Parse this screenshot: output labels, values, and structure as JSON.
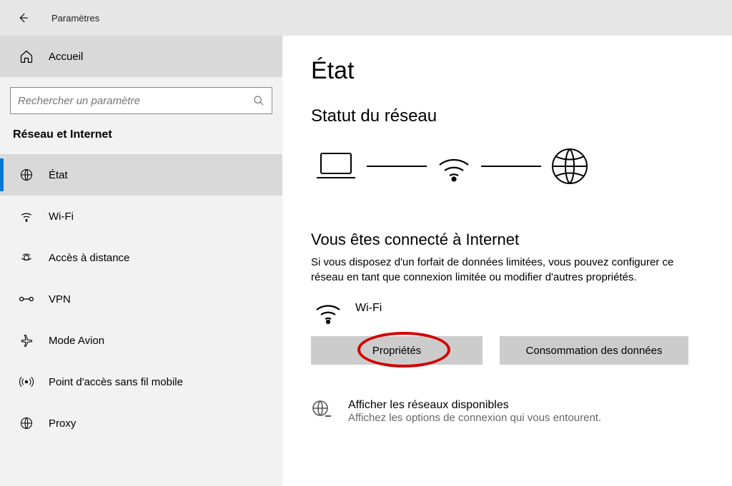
{
  "titlebar": {
    "title": "Paramètres"
  },
  "sidebar": {
    "home": "Accueil",
    "search_placeholder": "Rechercher un paramètre",
    "section": "Réseau et Internet",
    "items": [
      {
        "label": "État"
      },
      {
        "label": "Wi-Fi"
      },
      {
        "label": "Accès à distance"
      },
      {
        "label": "VPN"
      },
      {
        "label": "Mode Avion"
      },
      {
        "label": "Point d'accès sans fil mobile"
      },
      {
        "label": "Proxy"
      }
    ]
  },
  "content": {
    "title": "État",
    "subhead": "Statut du réseau",
    "connected_head": "Vous êtes connecté à Internet",
    "connected_desc": "Si vous disposez d'un forfait de données limitées, vous pouvez configurer ce réseau en tant que connexion limitée ou modifier d'autres propriétés.",
    "wifi_label": "Wi-Fi",
    "btn_properties": "Propriétés",
    "btn_data_usage": "Consommation des données",
    "link_networks_title": "Afficher les réseaux disponibles",
    "link_networks_sub": "Affichez les options de connexion qui vous entourent."
  }
}
